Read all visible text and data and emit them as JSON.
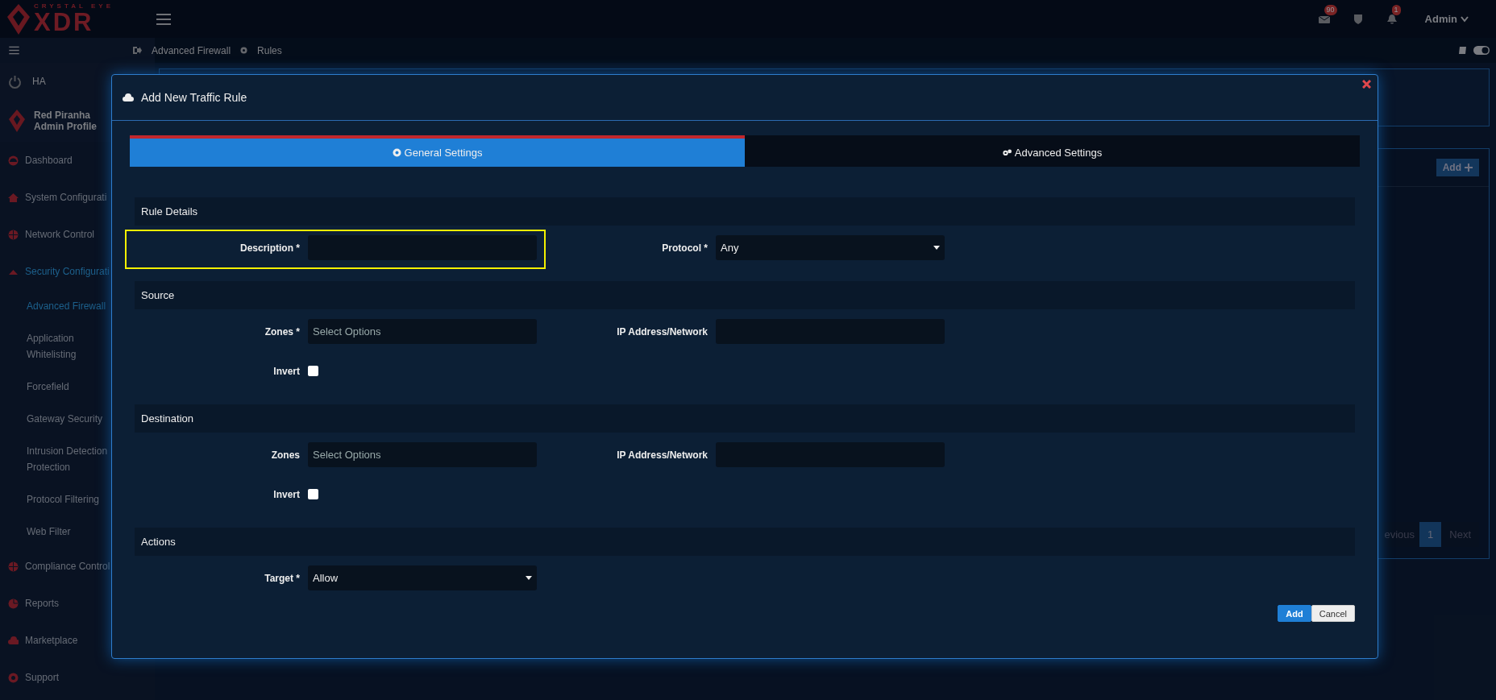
{
  "header": {
    "logo_top": "CRYSTAL EYE",
    "logo_main": "XDR",
    "notifications": [
      {
        "kind": "mail",
        "count": "90"
      },
      {
        "kind": "shield"
      },
      {
        "kind": "bell",
        "count": "1"
      }
    ],
    "user": "Admin"
  },
  "breadcrumb": [
    "Advanced Firewall",
    "Rules"
  ],
  "sidebar": {
    "ha": "HA",
    "profile": {
      "name": "Red Piranha",
      "role": "Admin Profile"
    },
    "items": [
      {
        "label": "Dashboard",
        "selected": false
      },
      {
        "label": "System Configurati",
        "selected": false
      },
      {
        "label": "Network Control",
        "selected": false
      },
      {
        "label": "Security Configurati",
        "selected": true,
        "children": [
          {
            "label": "Advanced Firewall",
            "selected": true
          },
          {
            "label": "Application Whitelisting",
            "selected": false
          },
          {
            "label": "Forcefield",
            "selected": false
          },
          {
            "label": "Gateway Security",
            "selected": false
          },
          {
            "label": "Intrusion Detection Protection",
            "selected": false
          },
          {
            "label": "Protocol Filtering",
            "selected": false
          },
          {
            "label": "Web Filter",
            "selected": false
          }
        ]
      },
      {
        "label": "Compliance Control",
        "selected": false
      },
      {
        "label": "Reports",
        "selected": false
      },
      {
        "label": "Marketplace",
        "selected": false
      },
      {
        "label": "Support",
        "selected": false
      }
    ]
  },
  "background_panel": {
    "add_button": "Add",
    "pagination": {
      "previous": "evious",
      "pages": [
        {
          "label": "1",
          "selected": true
        }
      ],
      "next": "Next"
    }
  },
  "modal": {
    "title": "Add New Traffic Rule",
    "tabs": [
      {
        "label": "General Settings",
        "selected": true
      },
      {
        "label": "Advanced Settings",
        "selected": false
      }
    ],
    "sections": [
      {
        "title": "Rule Details",
        "rows": [
          [
            {
              "kind": "input",
              "label": "Description *",
              "highlighted": true
            },
            {
              "kind": "select",
              "label": "Protocol *",
              "value": "Any"
            }
          ]
        ]
      },
      {
        "title": "Source",
        "rows": [
          [
            {
              "kind": "input",
              "label": "Zones *",
              "placeholder": "Select Options"
            },
            {
              "kind": "input",
              "label": "IP Address/Network"
            }
          ],
          [
            {
              "kind": "checkbox",
              "label": "Invert",
              "checked": false
            }
          ]
        ]
      },
      {
        "title": "Destination",
        "rows": [
          [
            {
              "kind": "input",
              "label": "Zones",
              "placeholder": "Select Options"
            },
            {
              "kind": "input",
              "label": "IP Address/Network"
            }
          ],
          [
            {
              "kind": "checkbox",
              "label": "Invert",
              "checked": false
            }
          ]
        ]
      },
      {
        "title": "Actions",
        "rows": [
          [
            {
              "kind": "select",
              "label": "Target *",
              "value": "Allow"
            }
          ]
        ]
      }
    ],
    "buttons": [
      {
        "label": "Add",
        "kind": "primary"
      },
      {
        "label": "Cancel",
        "kind": "default"
      }
    ]
  }
}
